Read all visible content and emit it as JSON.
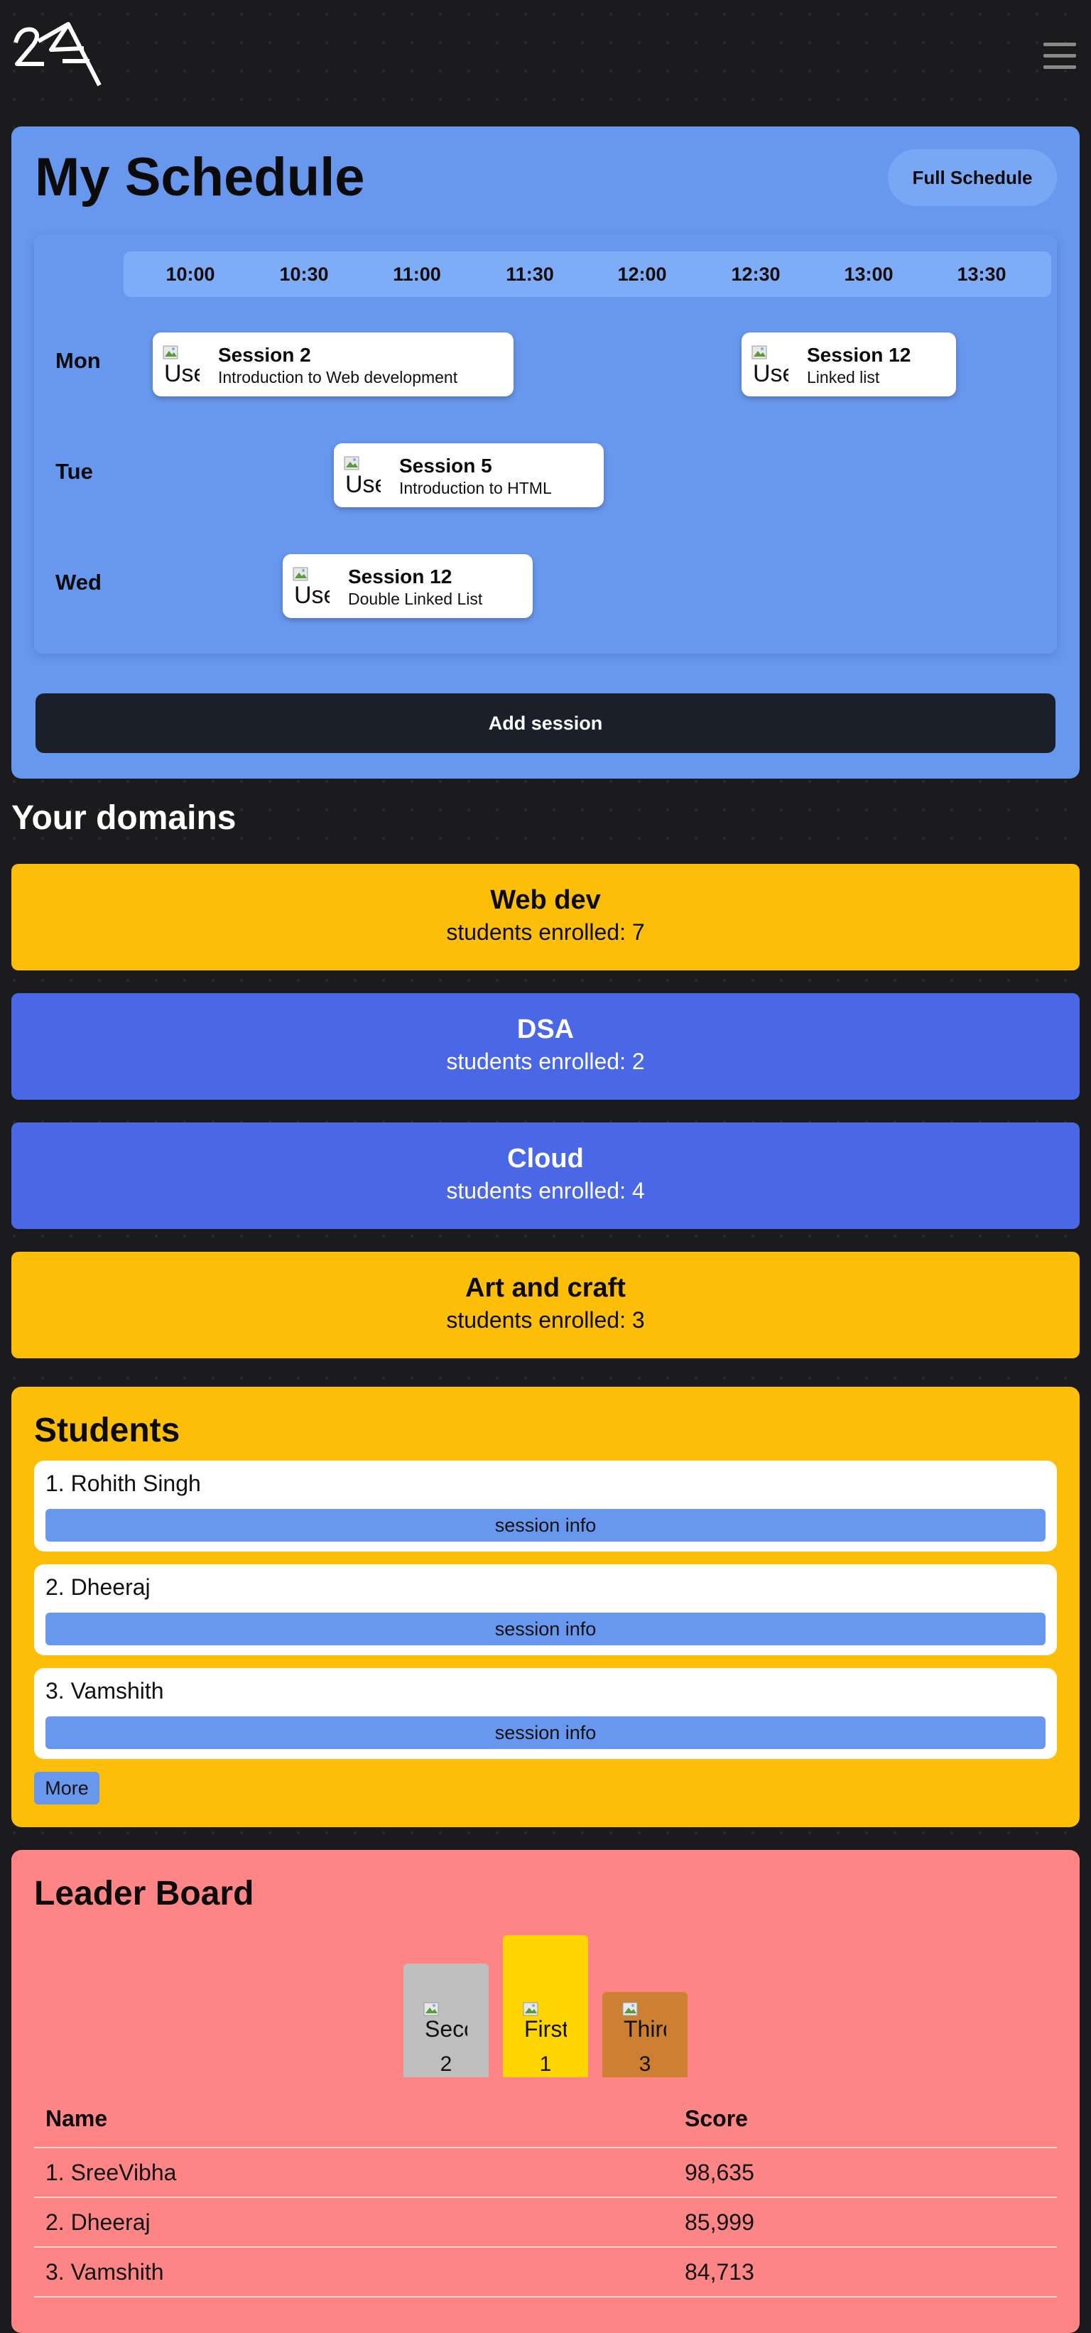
{
  "header": {
    "logo_text": "2ZA",
    "menu_icon": "hamburger-menu-icon"
  },
  "schedule": {
    "title": "My Schedule",
    "full_schedule_label": "Full Schedule",
    "times": [
      "10:00",
      "10:30",
      "11:00",
      "11:30",
      "12:00",
      "12:30",
      "13:00",
      "13:30"
    ],
    "days": [
      "Mon",
      "Tue",
      "Wed"
    ],
    "sessions": [
      {
        "day": "Mon",
        "title": "Session 2",
        "subtitle": "Introduction to Web development",
        "avatar_alt": "User"
      },
      {
        "day": "Mon",
        "title": "Session 12",
        "subtitle": "Linked list",
        "avatar_alt": "User"
      },
      {
        "day": "Tue",
        "title": "Session 5",
        "subtitle": "Introduction to HTML",
        "avatar_alt": "User"
      },
      {
        "day": "Wed",
        "title": "Session 12",
        "subtitle": "Double Linked List",
        "avatar_alt": "User"
      }
    ],
    "add_session_label": "Add session"
  },
  "domains_section": {
    "title": "Your domains",
    "domains": [
      {
        "name": "Web dev",
        "enrolled": "students enrolled: 7",
        "color": "#fdbe08"
      },
      {
        "name": "DSA",
        "enrolled": "students enrolled: 2",
        "color": "#4a67e6"
      },
      {
        "name": "Cloud",
        "enrolled": "students enrolled: 4",
        "color": "#4a67e6"
      },
      {
        "name": "Art and craft",
        "enrolled": "students enrolled: 3",
        "color": "#fdbe08"
      }
    ]
  },
  "students": {
    "title": "Students",
    "items": [
      {
        "name": "1. Rohith Singh",
        "button": "session info"
      },
      {
        "name": "2. Dheeraj",
        "button": "session info"
      },
      {
        "name": "3. Vamshith",
        "button": "session info"
      }
    ],
    "more_label": "More"
  },
  "leaderboard": {
    "title": "Leader Board",
    "podium": [
      {
        "rank": "2",
        "alt": "Second",
        "color": "#bfbfbf"
      },
      {
        "rank": "1",
        "alt": "First",
        "color": "#ffd500"
      },
      {
        "rank": "3",
        "alt": "Third",
        "color": "#cd7f32"
      }
    ],
    "columns": [
      "Name",
      "Score"
    ],
    "rows": [
      {
        "name": "1. SreeVibha",
        "score": "98,635"
      },
      {
        "name": "2. Dheeraj",
        "score": "85,999"
      },
      {
        "name": "3. Vamshith",
        "score": "84,713"
      }
    ]
  }
}
